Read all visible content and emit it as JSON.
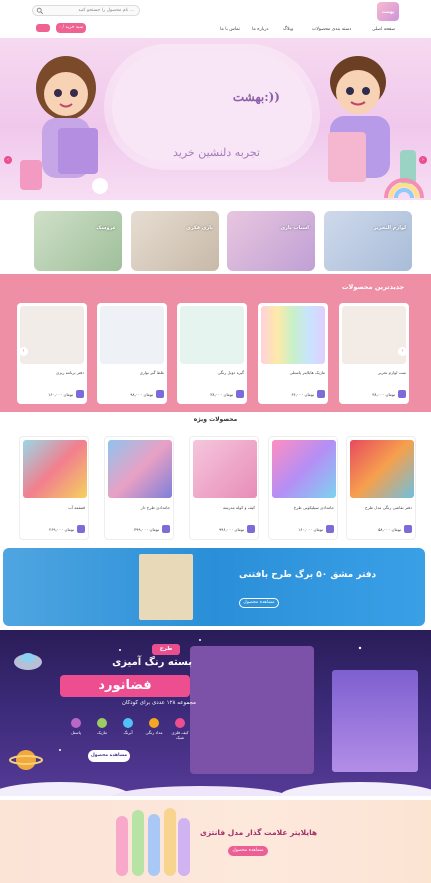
{
  "header": {
    "search_placeholder": "نام محصول را جستجو کنید ...",
    "cart_label": "۰ / سبد خرید",
    "logo_text": "بهشت"
  },
  "nav": {
    "items": [
      "صفحه اصلی",
      "دسته بندی محصولات",
      "وبلاگ",
      "درباره ما",
      "تماس با ما"
    ]
  },
  "hero": {
    "brand": "بهشت:))",
    "tagline": "تجربه دلنشین خرید",
    "prev_icon": "‹",
    "next_icon": "›"
  },
  "categories": [
    {
      "label": "لوازم التحریر"
    },
    {
      "label": "اسباب بازی"
    },
    {
      "label": "بازی فکری"
    },
    {
      "label": ""
    },
    {
      "label": "عروسک"
    }
  ],
  "new_products": {
    "title": "جدیدترین محصولات",
    "items": [
      {
        "name": "ست لوازم تحریر",
        "price": "۳۸,۰۰۰ تومان"
      },
      {
        "name": "ماژیک هایلایتر پاستلی",
        "price": "۶۴,۰۰۰ تومان"
      },
      {
        "name": "گیره دوبل رنگی",
        "price": "۳۸,۰۰۰ تومان"
      },
      {
        "name": "غلط گیر نواری",
        "price": "۹۸,۰۰۰ تومان"
      },
      {
        "name": "دفتر برنامه ریزی",
        "price": "۱۶۰,۰۰۰ تومان"
      }
    ]
  },
  "special_products": {
    "title": "محصولات ویژه",
    "items": [
      {
        "name": "دفتر نقاشی رنگی مدل طرح",
        "price": "۵۸,۰۰۰ تومان"
      },
      {
        "name": "جامدادی سیلیکونی طرح",
        "price": "۱۶۰,۰۰۰ تومان"
      },
      {
        "name": "کیف و کوله مدرسه",
        "price": "۹۹۶,۰۰۰ تومان"
      },
      {
        "name": "جامدادی طرح دار",
        "price": "۳۹۹,۰۰۰ تومان"
      },
      {
        "name": "قمقمه آب",
        "price": "۲۶۹,۰۰۰ تومان"
      }
    ]
  },
  "notebook_banner": {
    "title": "دفتر مشق ۵۰ برگ طرح بافتنی",
    "button": "مشاهده محصول"
  },
  "space_banner": {
    "badge": "طرح",
    "line1": "بسته رنگ آمیزی",
    "line2": "فضانورد",
    "line3": "مجموعه ۱۲۸ عددی برای کودکان",
    "features": [
      "کیف فلزی شیک",
      "مداد رنگی",
      "آبرنگ",
      "ماژیک",
      "پاستل"
    ],
    "button": "مشاهده محصول"
  },
  "highlighter_banner": {
    "title": "هایلایتر علامت گذار مدل فانتزی",
    "button": "مشاهده محصول"
  },
  "colors": {
    "accent": "#ec4f8f",
    "new_section_bg": "#ef8fa6",
    "cart_button": "#7b6cd9"
  }
}
